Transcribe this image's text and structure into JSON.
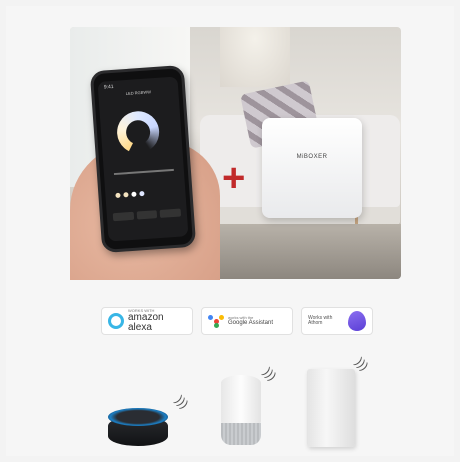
{
  "phone": {
    "time": "9:41",
    "screen_title": "LED RGBWW"
  },
  "hub": {
    "brand": "MiBOXER"
  },
  "badges": {
    "alexa": {
      "small": "WORKS WITH",
      "big": "amazon alexa"
    },
    "google": {
      "small": "works with the",
      "big": "Google Assistant"
    },
    "homey": {
      "small": "Works with Athom"
    }
  },
  "colors": {
    "plus": "#c12a2a",
    "alexa_ring": "#38b6e6",
    "homey": "#6a4fe0"
  },
  "icons": [
    "plus-icon",
    "wifi-icon",
    "alexa-icon",
    "google-assistant-icon",
    "homey-icon"
  ]
}
